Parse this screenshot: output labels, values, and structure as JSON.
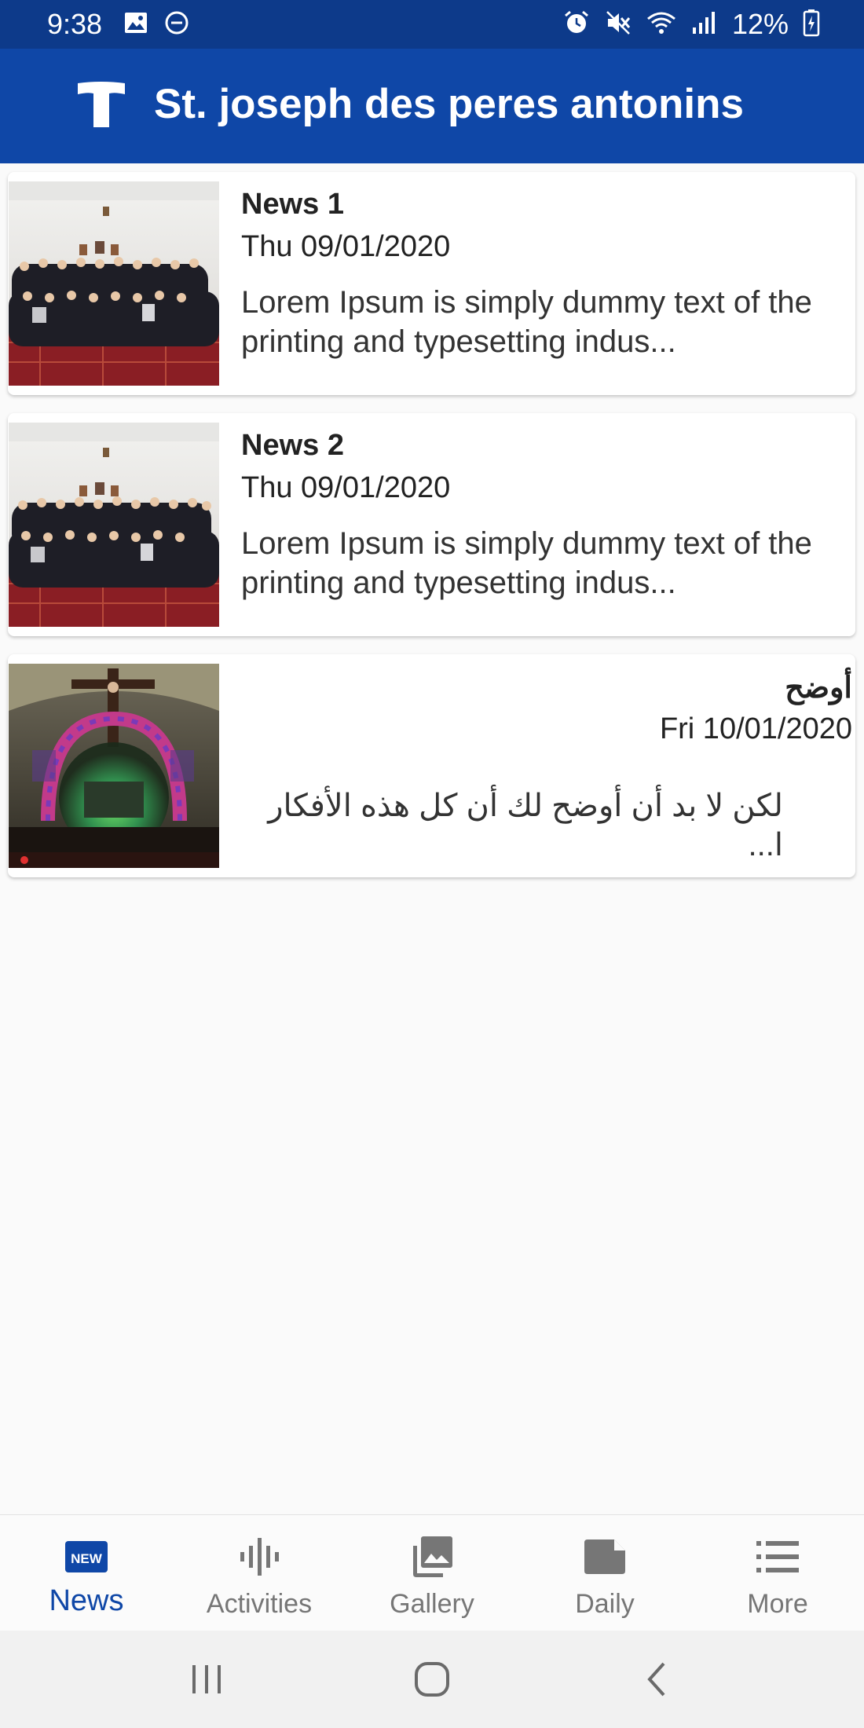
{
  "status_bar": {
    "time": "9:38",
    "battery_percent": "12%"
  },
  "app_bar": {
    "title": "St.  joseph des peres antonins",
    "background": "#0f47a7"
  },
  "news": [
    {
      "title": "News 1",
      "date": "Thu 09/01/2020",
      "excerpt": "Lorem Ipsum is simply dummy text of the printing and typesetting indus..."
    },
    {
      "title": "News 2",
      "date": "Thu 09/01/2020",
      "excerpt": "Lorem Ipsum is simply dummy text of the printing and typesetting indus..."
    },
    {
      "title": "أوضح",
      "date": "Fri 10/01/2020",
      "excerpt": "لكن لا بد أن أوضح لك أن كل هذه الأفكار ا..."
    }
  ],
  "bottom_nav": {
    "news": {
      "label": "News",
      "badge": "NEW",
      "active": true
    },
    "activities": {
      "label": "Activities"
    },
    "gallery": {
      "label": "Gallery"
    },
    "daily": {
      "label": "Daily"
    },
    "more": {
      "label": "More"
    }
  },
  "colors": {
    "primary": "#0f47a7",
    "status_bar": "#0d3a8a",
    "inactive": "#767676"
  },
  "icons": [
    "image-icon",
    "do-not-disturb-icon",
    "alarm-icon",
    "mute-icon",
    "wifi-icon",
    "signal-icon",
    "battery-icon",
    "app-logo-icon",
    "news-icon",
    "activities-icon",
    "gallery-icon",
    "daily-icon",
    "more-icon",
    "recents-icon",
    "home-icon",
    "back-icon"
  ]
}
